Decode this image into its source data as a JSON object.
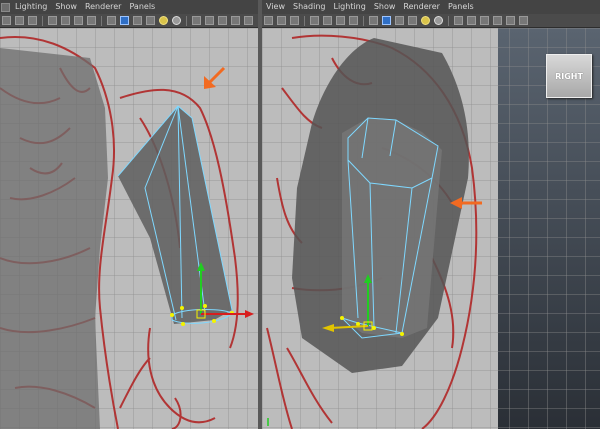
{
  "left_viewport": {
    "menu": [
      "Lighting",
      "Show",
      "Renderer",
      "Panels"
    ]
  },
  "right_viewport": {
    "menu": [
      "View",
      "Shading",
      "Lighting",
      "Show",
      "Renderer",
      "Panels"
    ],
    "view_cube_label": "RIGHT"
  },
  "colors": {
    "viewport_grey": "#bcbcbc",
    "grid_line": "#8e8e8e",
    "sketch_red": "#b01e1e",
    "mesh_fill": "#6a6a6a",
    "wire_cyan": "#7fd8ff",
    "arrow_orange": "#f26a21"
  },
  "icons": [
    "lighting-menu-icon",
    "view-cube-icon",
    "annotation-arrow-icon",
    "move-manipulator-icon"
  ]
}
